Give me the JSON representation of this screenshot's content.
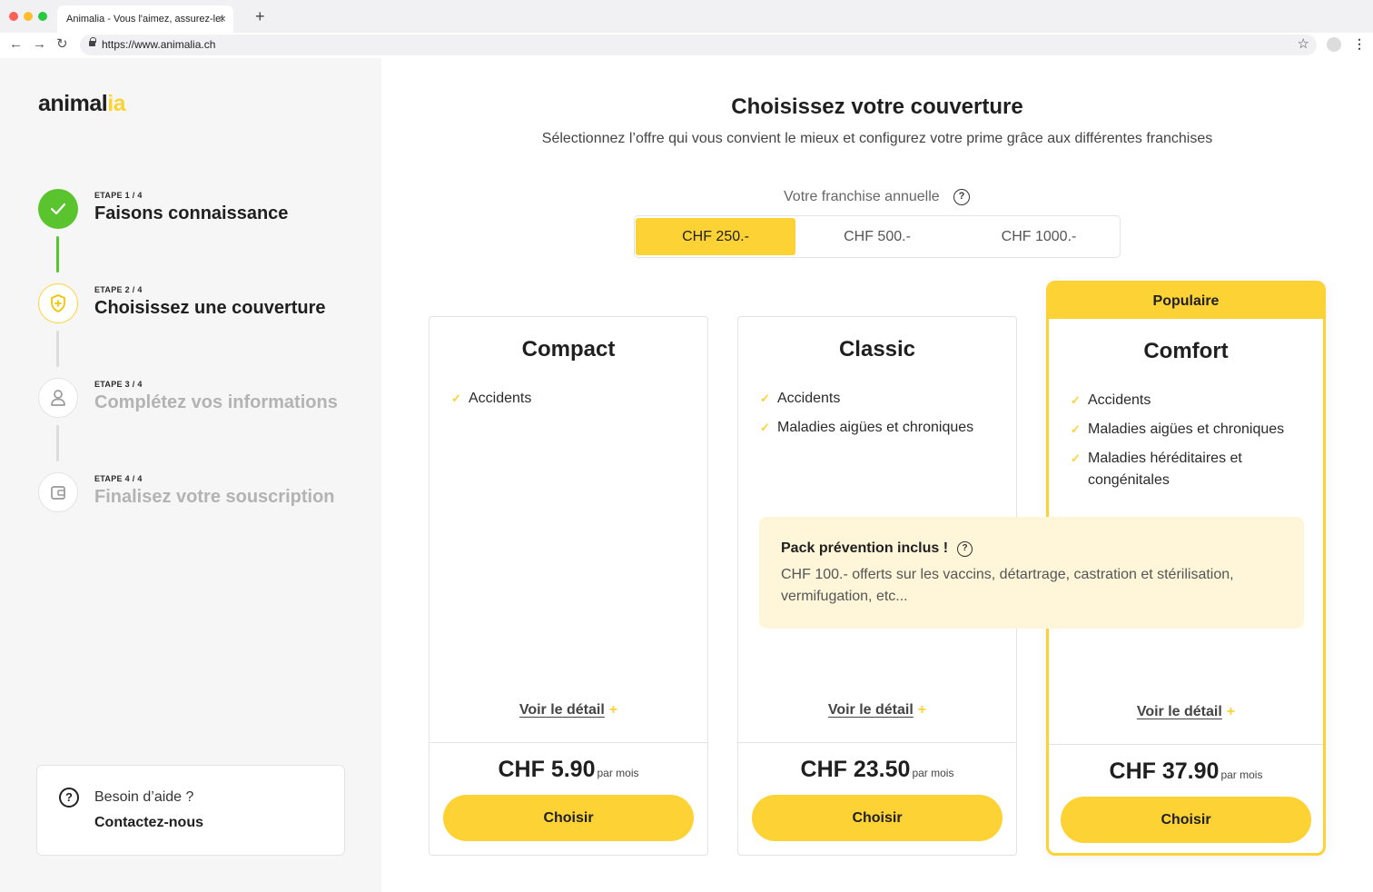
{
  "browser": {
    "tab_title": "Animalia - Vous l'aimez, assurez-le!",
    "tab_close": "×",
    "new_tab": "+",
    "url": "https://www.animalia.ch",
    "back": "←",
    "forward": "→",
    "reload": "↻",
    "bookmark": "☆",
    "menu": "⋮"
  },
  "sidebar": {
    "logo_main": "animal",
    "logo_accent": "ia",
    "steps": [
      {
        "label": "ETAPE 1 / 4",
        "title": "Faisons connaissance",
        "status": "done",
        "icon": "check-icon"
      },
      {
        "label": "ETAPE 2 / 4",
        "title": "Choisissez une couverture",
        "status": "active",
        "icon": "shield-plus-icon"
      },
      {
        "label": "ETAPE 3 / 4",
        "title": "Complétez vos informations",
        "status": "todo",
        "icon": "user-icon"
      },
      {
        "label": "ETAPE 4 / 4",
        "title": "Finalisez votre souscription",
        "status": "todo",
        "icon": "wallet-icon"
      }
    ],
    "help": {
      "icon": "?",
      "question": "Besoin d’aide ?",
      "link": "Contactez-nous"
    }
  },
  "main": {
    "title": "Choisissez votre couverture",
    "subtitle": "Sélectionnez l’offre qui vous convient le mieux et configurez votre prime grâce aux différentes franchises",
    "franchise": {
      "label": "Votre franchise annuelle",
      "info": "?",
      "options": [
        "CHF 250.-",
        "CHF 500.-",
        "CHF 1000.-"
      ],
      "selected": "CHF 250.-"
    },
    "plans": [
      {
        "name": "Compact",
        "features": [
          "Accidents"
        ],
        "detail": "Voir le détail",
        "plus": "+",
        "price": "CHF 5.90",
        "per": "par mois",
        "cta": "Choisir"
      },
      {
        "name": "Classic",
        "features": [
          "Accidents",
          "Maladies aigües et chroniques"
        ],
        "detail": "Voir le détail",
        "plus": "+",
        "price": "CHF 23.50",
        "per": "par mois",
        "cta": "Choisir"
      },
      {
        "name": "Comfort",
        "badge": "Populaire",
        "features": [
          "Accidents",
          "Maladies aigües et chroniques",
          "Maladies héréditaires et congénitales"
        ],
        "detail": "Voir le détail",
        "plus": "+",
        "price": "CHF 37.90",
        "per": "par mois",
        "cta": "Choisir"
      }
    ],
    "prevention": {
      "title": "Pack prévention inclus !",
      "info": "?",
      "text": "CHF 100.- offerts sur les vaccins, détartrage, castration et stérilisation, vermifugation, etc..."
    },
    "check_glyph": "✓"
  },
  "colors": {
    "accent": "#fdd235",
    "success": "#5ac42f",
    "sidebar_bg": "#f6f6f6",
    "highlight_bg": "#fff6d9"
  }
}
